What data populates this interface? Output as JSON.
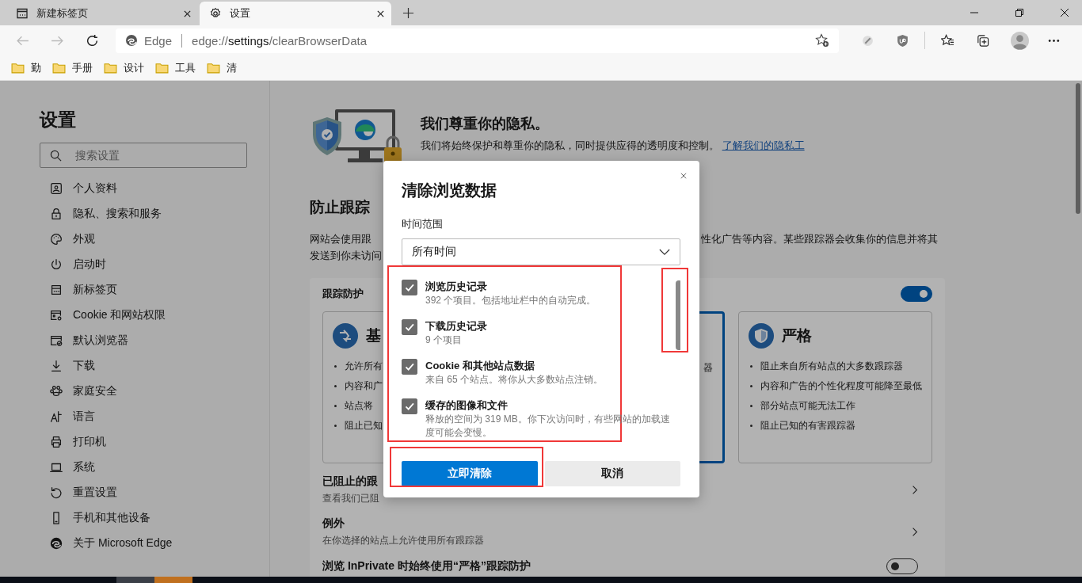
{
  "tabs": [
    {
      "title": "新建标签页",
      "selected": false
    },
    {
      "title": "设置",
      "selected": true
    }
  ],
  "address_bar": {
    "site_label": "Edge",
    "url_scheme": "edge://",
    "url_host": "settings",
    "url_path": "/clearBrowserData"
  },
  "bookmarks": [
    "勤",
    "手册",
    "设计",
    "工具",
    "清"
  ],
  "sidebar": {
    "title": "设置",
    "search_placeholder": "搜索设置",
    "items": [
      "个人资料",
      "隐私、搜索和服务",
      "外观",
      "启动时",
      "新标签页",
      "Cookie 和网站权限",
      "默认浏览器",
      "下载",
      "家庭安全",
      "语言",
      "打印机",
      "系统",
      "重置设置",
      "手机和其他设备",
      "关于 Microsoft Edge"
    ]
  },
  "privacy_banner": {
    "title": "我们尊重你的隐私。",
    "text": "我们将始终保护和尊重你的隐私，同时提供应得的透明度和控制。",
    "link": "了解我们的隐私工"
  },
  "tracking": {
    "heading": "防止跟踪",
    "description_line_1_left": "网站会使用跟",
    "description_line_1_right": "性化广告等内容。某些跟踪器会收集你的信息并将其",
    "description_line_2_left": "发送到你未访问"
  },
  "tracking_protection": {
    "label": "跟踪防护",
    "on": true,
    "cards": [
      {
        "title": "基",
        "bullets": [
          "允许所有",
          "内容和广",
          "站点将",
          "阻止已知"
        ],
        "selected": false
      },
      {
        "bullets": [
          "器"
        ],
        "selected": true
      },
      {
        "title": "严格",
        "bullets": [
          "阻止来自所有站点的大多数跟踪器",
          "内容和广告的个性化程度可能降至最低",
          "部分站点可能无法工作",
          "阻止已知的有害跟踪器"
        ],
        "selected": false
      }
    ]
  },
  "rows": [
    {
      "kind": "link",
      "title": "已阻止的跟",
      "subtitle": "查看我们已阻"
    },
    {
      "kind": "link",
      "title": "例外",
      "subtitle": "在你选择的站点上允许使用所有跟踪器"
    },
    {
      "kind": "toggle",
      "title": "浏览 InPrivate 时始终使用“严格”跟踪防护",
      "on": false
    }
  ],
  "dialog": {
    "title": "清除浏览数据",
    "range_label": "时间范围",
    "range_value": "所有时间",
    "items": [
      {
        "title": "浏览历史记录",
        "detail": "392 个项目。包括地址栏中的自动完成。",
        "checked": true
      },
      {
        "title": "下载历史记录",
        "detail": "9 个项目",
        "checked": true
      },
      {
        "title": "Cookie 和其他站点数据",
        "detail": "来自 65 个站点。将你从大多数站点注销。",
        "checked": true
      },
      {
        "title": "缓存的图像和文件",
        "detail": "释放的空间为 319 MB。你下次访问时，有些网站的加载速度可能会变慢。",
        "checked": true
      }
    ],
    "primary_button": "立即清除",
    "cancel_button": "取消"
  },
  "highlights": [
    {
      "kind": "data_types"
    },
    {
      "kind": "scrollbar"
    },
    {
      "kind": "clear_button"
    }
  ]
}
